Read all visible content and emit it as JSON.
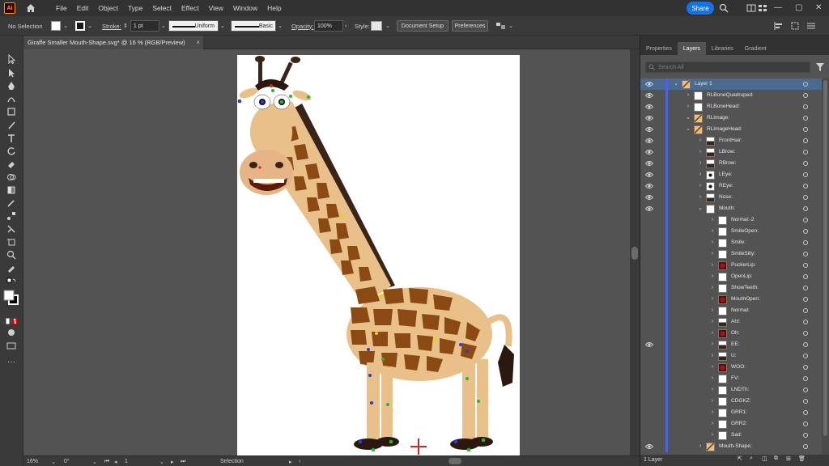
{
  "app": {
    "logo_text": "Ai"
  },
  "menu": [
    "File",
    "Edit",
    "Object",
    "Type",
    "Select",
    "Effect",
    "View",
    "Window",
    "Help"
  ],
  "share_label": "Share",
  "control": {
    "selection_label": "No Selection",
    "stroke_label": "Stroke:",
    "stroke_weight": "1 pt",
    "profile_uniform": "Uniform",
    "brush_basic": "Basic",
    "opacity_label": "Opacity:",
    "opacity_value": "100%",
    "style_label": "Style:",
    "doc_setup": "Document Setup",
    "preferences": "Preferences"
  },
  "document": {
    "tab_title": "Giraffe Smaller Mouth-Shape.svg* @ 16 % (RGB/Preview)",
    "close_glyph": "×"
  },
  "status": {
    "zoom": "16%",
    "rotation": "0°",
    "artboard_num": "1",
    "tool_label": "Selection"
  },
  "panel": {
    "tabs": [
      "Properties",
      "Layers",
      "Libraries",
      "Gradient"
    ],
    "active_tab": "Layers",
    "search_placeholder": "Search All",
    "footer_label": "1 Layer",
    "layers": [
      {
        "name": "Layer 1",
        "indent": 0,
        "arrow": "down",
        "eye": true,
        "selected": true,
        "thumb": "art"
      },
      {
        "name": "RLBoneQuadruped:",
        "indent": 1,
        "arrow": "right",
        "eye": true,
        "thumb": "white"
      },
      {
        "name": "RLBoneHead:",
        "indent": 1,
        "arrow": "right",
        "eye": true,
        "thumb": "white"
      },
      {
        "name": "RLImage:",
        "indent": 1,
        "arrow": "down",
        "eye": true,
        "thumb": "art"
      },
      {
        "name": "RLImageHead:",
        "indent": 2,
        "arrow": "down",
        "eye": true,
        "thumb": "art"
      },
      {
        "name": "FrontHair:",
        "indent": 3,
        "arrow": "right",
        "eye": true,
        "thumb": "dark"
      },
      {
        "name": "LBrow:",
        "indent": 3,
        "arrow": "right",
        "eye": true,
        "thumb": "dark"
      },
      {
        "name": "RBrow:",
        "indent": 3,
        "arrow": "right",
        "eye": true,
        "thumb": "dark"
      },
      {
        "name": "LEye:",
        "indent": 3,
        "arrow": "right",
        "eye": true,
        "thumb": "eye"
      },
      {
        "name": "REye:",
        "indent": 3,
        "arrow": "right",
        "eye": true,
        "thumb": "eye"
      },
      {
        "name": "Nose:",
        "indent": 3,
        "arrow": "right",
        "eye": true,
        "thumb": "dark"
      },
      {
        "name": "Mouth:",
        "indent": 3,
        "arrow": "down",
        "eye": true,
        "thumb": "white"
      },
      {
        "name": "Normal:-2",
        "indent": 4,
        "arrow": "right",
        "eye": false,
        "thumb": "white"
      },
      {
        "name": "SmileOpen:",
        "indent": 4,
        "arrow": "right",
        "eye": false,
        "thumb": "white"
      },
      {
        "name": "Smile:",
        "indent": 4,
        "arrow": "right",
        "eye": false,
        "thumb": "white"
      },
      {
        "name": "SmileSilly:",
        "indent": 4,
        "arrow": "right",
        "eye": false,
        "thumb": "white"
      },
      {
        "name": "PuckerLip:",
        "indent": 4,
        "arrow": "right",
        "eye": false,
        "thumb": "red"
      },
      {
        "name": "OpenLip:",
        "indent": 4,
        "arrow": "right",
        "eye": false,
        "thumb": "white"
      },
      {
        "name": "ShowTeeth:",
        "indent": 4,
        "arrow": "right",
        "eye": false,
        "thumb": "white"
      },
      {
        "name": "MouthOpen:",
        "indent": 4,
        "arrow": "right",
        "eye": false,
        "thumb": "red"
      },
      {
        "name": "Normal:",
        "indent": 4,
        "arrow": "right",
        "eye": false,
        "thumb": "white"
      },
      {
        "name": "Ah!:",
        "indent": 4,
        "arrow": "right",
        "eye": false,
        "thumb": "dark"
      },
      {
        "name": "Oh:",
        "indent": 4,
        "arrow": "right",
        "eye": false,
        "thumb": "red"
      },
      {
        "name": "EE:",
        "indent": 4,
        "arrow": "right",
        "eye": true,
        "thumb": "dark"
      },
      {
        "name": "U:",
        "indent": 4,
        "arrow": "right",
        "eye": false,
        "thumb": "dark"
      },
      {
        "name": "WOO:",
        "indent": 4,
        "arrow": "right",
        "eye": false,
        "thumb": "red"
      },
      {
        "name": "FV:",
        "indent": 4,
        "arrow": "right",
        "eye": false,
        "thumb": "white"
      },
      {
        "name": "LNDTh:",
        "indent": 4,
        "arrow": "right",
        "eye": false,
        "thumb": "white"
      },
      {
        "name": "CDGKZ:",
        "indent": 4,
        "arrow": "right",
        "eye": false,
        "thumb": "white"
      },
      {
        "name": "GRR1:",
        "indent": 4,
        "arrow": "right",
        "eye": false,
        "thumb": "white"
      },
      {
        "name": "GRR2:",
        "indent": 4,
        "arrow": "right",
        "eye": false,
        "thumb": "white"
      },
      {
        "name": "Sad:",
        "indent": 4,
        "arrow": "right",
        "eye": false,
        "thumb": "white"
      },
      {
        "name": "Mouth-Shape:",
        "indent": 3,
        "arrow": "right",
        "eye": true,
        "thumb": "art"
      }
    ]
  },
  "colors": {
    "accent": "#1473e6",
    "layer_color": "#4f63e0",
    "selected_row": "#4b6a8f",
    "giraffe_body": "#e9c089",
    "giraffe_spots": "#8b4a14"
  }
}
